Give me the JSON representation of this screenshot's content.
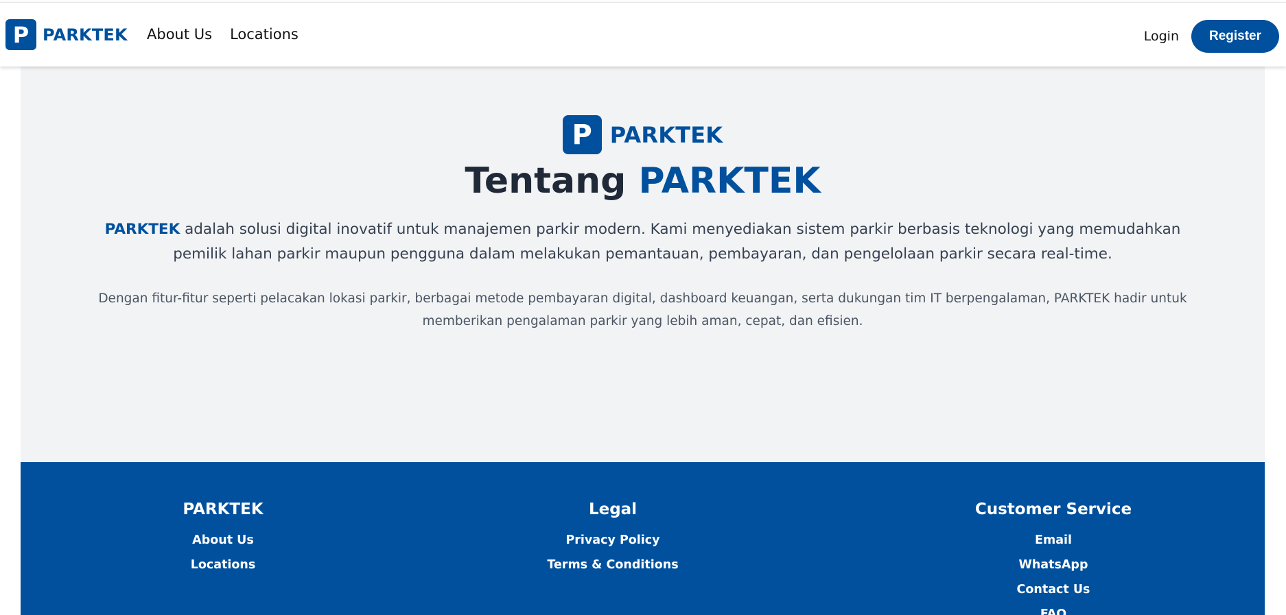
{
  "brand": {
    "logo_letter": "P",
    "name": "PARKTEK",
    "color": "#00509d"
  },
  "nav": {
    "links": [
      "About Us",
      "Locations"
    ],
    "login_label": "Login",
    "register_label": "Register"
  },
  "about": {
    "logo_letter": "P",
    "logo_name": "PARKTEK",
    "title_prefix": "Tentang",
    "title_accent": "PARKTEK",
    "lead_accent": "PARKTEK",
    "lead_text": " adalah solusi digital inovatif untuk manajemen parkir modern. Kami menyediakan sistem parkir berbasis teknologi yang memudahkan pemilik lahan parkir maupun pengguna dalam melakukan pemantauan, pembayaran, dan pengelolaan parkir secara real-time.",
    "sub_text": "Dengan fitur-fitur seperti pelacakan lokasi parkir, berbagai metode pembayaran digital, dashboard keuangan, serta dukungan tim IT berpengalaman, PARKTEK hadir untuk memberikan pengalaman parkir yang lebih aman, cepat, dan efisien."
  },
  "footer": {
    "columns": [
      {
        "heading": "PARKTEK",
        "links": [
          "About Us",
          "Locations"
        ]
      },
      {
        "heading": "Legal",
        "links": [
          "Privacy Policy",
          "Terms & Conditions"
        ]
      },
      {
        "heading": "Customer Service",
        "links": [
          "Email",
          "WhatsApp",
          "Contact Us",
          "FAQ"
        ]
      }
    ]
  }
}
